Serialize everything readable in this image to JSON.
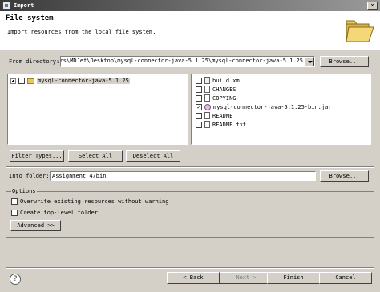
{
  "window": {
    "title": "Import"
  },
  "header": {
    "title": "File system",
    "description": "Import resources from the local file system."
  },
  "from_directory": {
    "label": "From directory:",
    "value": "s\\Users\\MDJef\\Desktop\\mysql-connector-java-5.1.25\\mysql-connector-java-5.1.25",
    "browse_label": "Browse..."
  },
  "tree": {
    "items": [
      {
        "label": "mysql-connector-java-5.1.25",
        "checked": false
      }
    ]
  },
  "files": [
    {
      "label": "build.xml",
      "checked": false,
      "icon": "xml-file-icon"
    },
    {
      "label": "CHANGES",
      "checked": false,
      "icon": "file-icon"
    },
    {
      "label": "COPYING",
      "checked": false,
      "icon": "file-icon"
    },
    {
      "label": "mysql-connector-java-5.1.25-bin.jar",
      "checked": true,
      "icon": "jar-file-icon"
    },
    {
      "label": "README",
      "checked": false,
      "icon": "file-icon"
    },
    {
      "label": "README.txt",
      "checked": false,
      "icon": "file-icon"
    }
  ],
  "filter_buttons": {
    "filter": "Filter Types...",
    "select_all": "Select All",
    "deselect_all": "Deselect All"
  },
  "into_folder": {
    "label": "Into folder:",
    "value": "Assignment 4/bin",
    "browse_label": "Browse..."
  },
  "options": {
    "legend": "Options",
    "overwrite": "Overwrite existing resources without warning",
    "top_level": "Create top-level folder",
    "advanced": "Advanced >>"
  },
  "footer": {
    "back": "< Back",
    "next": "Next >",
    "finish": "Finish",
    "cancel": "Cancel"
  }
}
